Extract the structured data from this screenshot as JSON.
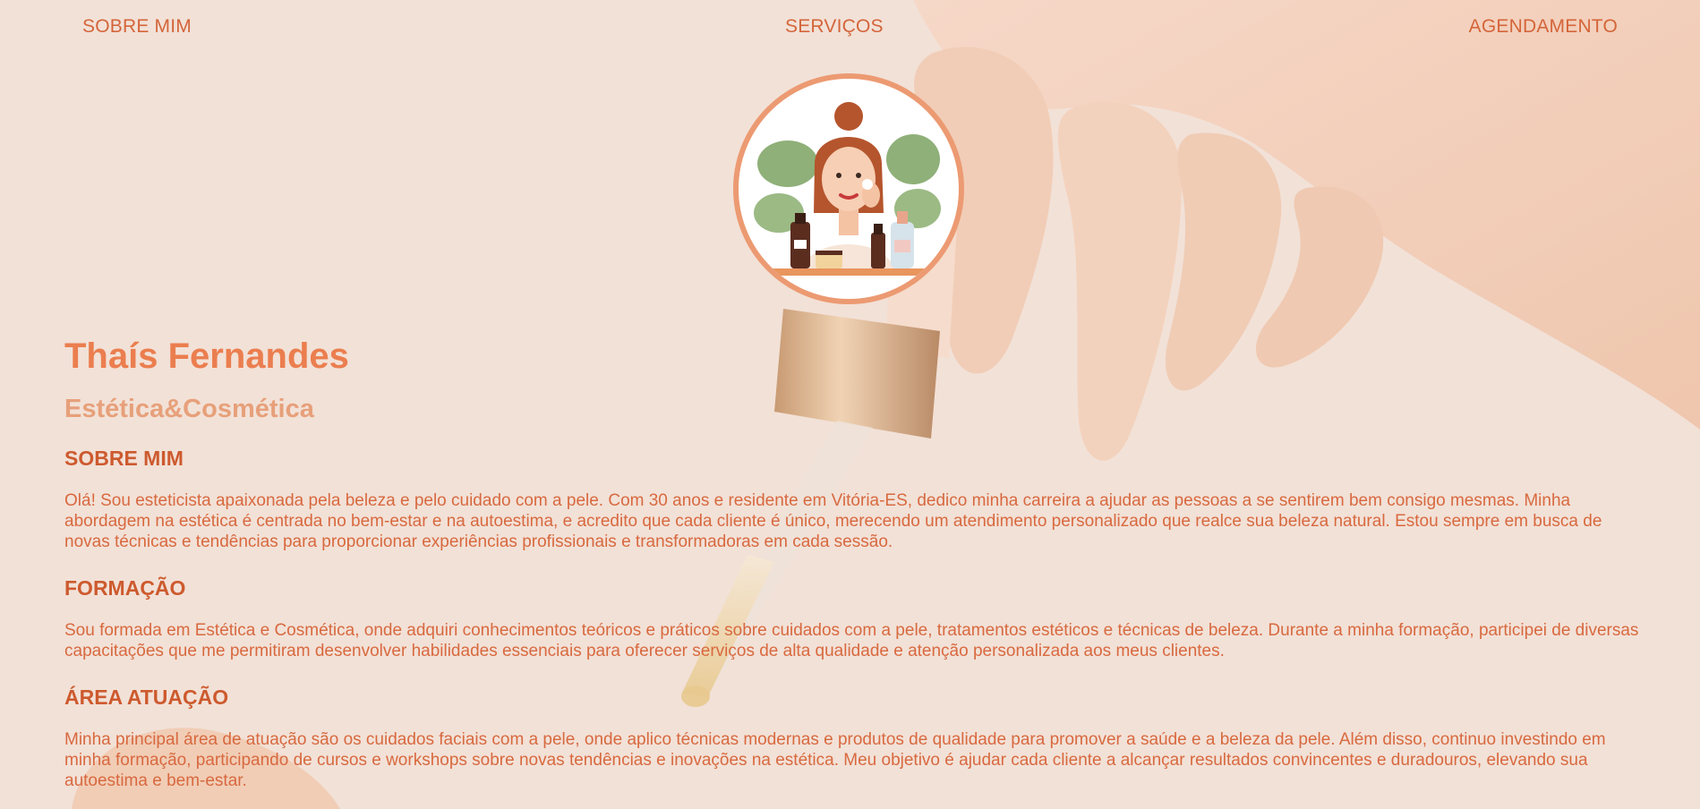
{
  "nav": {
    "sobre": "SOBRE MIM",
    "servicos": "SERVIÇOS",
    "agendamento": "AGENDAMENTO"
  },
  "logo": {
    "icon": "esthetician-illustration-icon"
  },
  "profile": {
    "name": "Thaís Fernandes",
    "subtitle": "Estética&Cosmética"
  },
  "sections": {
    "sobre": {
      "title": "SOBRE MIM",
      "text": "Olá! Sou esteticista apaixonada pela beleza e pelo cuidado com a pele. Com 30 anos e residente em Vitória-ES, dedico minha carreira a ajudar as pessoas a se sentirem bem consigo mesmas. Minha abordagem na estética é centrada no bem-estar e na autoestima, e acredito que cada cliente é único, merecendo um atendimento personalizado que realce sua beleza natural. Estou sempre em busca de novas técnicas e tendências para proporcionar experiências profissionais e transformadoras em cada sessão."
    },
    "formacao": {
      "title": "FORMAÇÃO",
      "text": "Sou formada em Estética e Cosmética, onde adquiri conhecimentos teóricos e práticos sobre cuidados com a pele, tratamentos estéticos e técnicas de beleza. Durante a minha formação, participei de diversas capacitações que me permitiram desenvolver habilidades essenciais para oferecer serviços de alta qualidade e atenção personalizada aos meus clientes."
    },
    "area": {
      "title": "ÁREA ATUAÇÃO",
      "text": "Minha principal área de atuação são os cuidados faciais com a pele, onde aplico técnicas modernas e produtos de qualidade para promover a saúde e a beleza da pele. Além disso, continuo investindo em minha formação, participando de cursos e workshops sobre novas tendências e inovações na estética. Meu objetivo é ajudar cada cliente a alcançar resultados convincentes e duradouros, elevando sua autoestima e bem-estar."
    }
  },
  "colors": {
    "background": "#f2e1d7",
    "accent": "#eb7e4f",
    "text": "#d8693f",
    "logo_border": "#ec9a72"
  }
}
